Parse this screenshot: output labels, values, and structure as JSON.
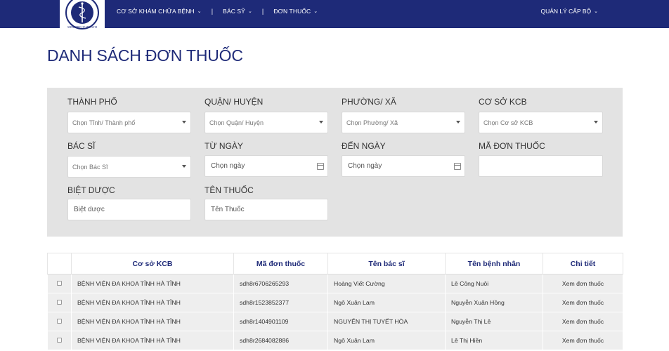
{
  "header": {
    "logo_text": "MINISTRY OF HEALTH",
    "nav": [
      {
        "label": "CƠ SỞ KHÁM CHỮA BỆNH"
      },
      {
        "label": "BÁC SỸ"
      },
      {
        "label": "ĐƠN THUỐC"
      }
    ],
    "separator": "|",
    "right_menu": "QUẢN LÝ CẤP BỘ"
  },
  "page": {
    "title": "DANH SÁCH ĐƠN THUỐC"
  },
  "filters": {
    "city": {
      "label": "THÀNH PHỐ",
      "placeholder": "Chọn Tỉnh/ Thành phố"
    },
    "district": {
      "label": "QUẬN/ HUYỆN",
      "placeholder": "Chọn Quận/ Huyện"
    },
    "ward": {
      "label": "PHƯỜNG/ XÃ",
      "placeholder": "Chọn Phường/ Xã"
    },
    "facility": {
      "label": "CƠ SỞ KCB",
      "placeholder": "Chọn Cơ sở KCB"
    },
    "doctor": {
      "label": "BÁC SĨ",
      "placeholder": "Chọn Bác Sĩ"
    },
    "from_date": {
      "label": "TỪ NGÀY",
      "placeholder": "Chọn ngày"
    },
    "to_date": {
      "label": "ĐẾN NGÀY",
      "placeholder": "Chọn ngày"
    },
    "prescription_code": {
      "label": "MÃ ĐƠN THUỐC",
      "placeholder": ""
    },
    "brand_drug": {
      "label": "BIỆT DƯỢC",
      "placeholder": "Biệt dược"
    },
    "drug_name": {
      "label": "TÊN THUỐC",
      "placeholder": "Tên Thuốc"
    }
  },
  "table": {
    "headers": [
      "Cơ sở KCB",
      "Mã đơn thuốc",
      "Tên bác sĩ",
      "Tên bệnh nhân",
      "Chi tiết"
    ],
    "rows": [
      {
        "facility": "BỆNH VIỆN ĐA KHOA TỈNH HÀ TĨNH",
        "code": "sdh8r6706265293",
        "doctor": "Hoàng Viết Cường",
        "patient": "Lê Công Nuôi",
        "detail": "Xem đơn thuốc"
      },
      {
        "facility": "BỆNH VIỆN ĐA KHOA TỈNH HÀ TĨNH",
        "code": "sdh8r1523852377",
        "doctor": "Ngô Xuân Lam",
        "patient": "Nguyễn Xuân Hồng",
        "detail": "Xem đơn thuốc"
      },
      {
        "facility": "BỆNH VIỆN ĐA KHOA TỈNH HÀ TĨNH",
        "code": "sdh8r1404901109",
        "doctor": "NGUYỄN THỊ TUYẾT HÒA",
        "patient": "Nguyễn Thị Lê",
        "detail": "Xem đơn thuốc"
      },
      {
        "facility": "BỆNH VIỆN ĐA KHOA TỈNH HÀ TĨNH",
        "code": "sdh8r2684082886",
        "doctor": "Ngô Xuân Lam",
        "patient": "Lê Thị Hiền",
        "detail": "Xem đơn thuốc"
      }
    ]
  },
  "colors": {
    "brand_navy": "#1e2a78",
    "filter_bg": "#e3e3e3",
    "row_bg": "#eeeeee"
  }
}
